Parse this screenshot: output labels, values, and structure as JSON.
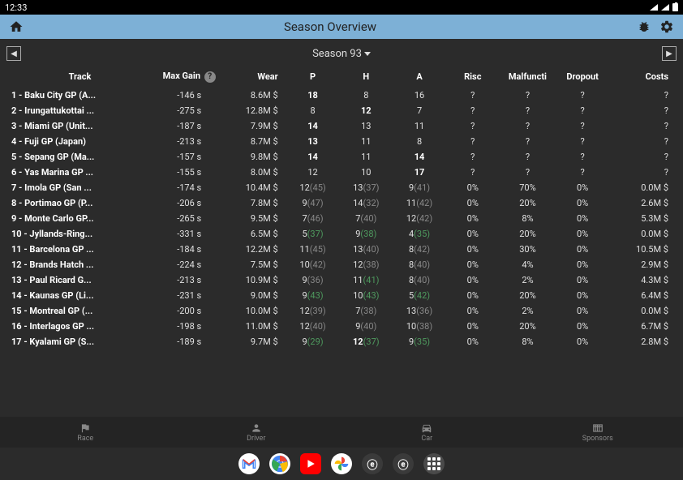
{
  "status_bar": {
    "time": "12:33"
  },
  "app_bar": {
    "title": "Season Overview"
  },
  "sub_header": {
    "season_label": "Season 93"
  },
  "table": {
    "headers": {
      "track": "Track",
      "max_gain": "Max Gain",
      "wear": "Wear",
      "p": "P",
      "h": "H",
      "a": "A",
      "risc": "Risc",
      "malfuncti": "Malfuncti",
      "dropout": "Dropout",
      "costs": "Costs"
    },
    "rows": [
      {
        "track": "1 - Baku City GP (A...",
        "max_gain": "-146 s",
        "wear": "8.6M $",
        "p": {
          "v": "18",
          "b": true
        },
        "h": {
          "v": "8"
        },
        "a": {
          "v": "16"
        },
        "risc": "?",
        "malf": "?",
        "drop": "?",
        "costs": "?"
      },
      {
        "track": "2 - Irungattukottai ...",
        "max_gain": "-275 s",
        "wear": "12.8M $",
        "p": {
          "v": "8"
        },
        "h": {
          "v": "12",
          "b": true
        },
        "a": {
          "v": "7"
        },
        "risc": "?",
        "malf": "?",
        "drop": "?",
        "costs": "?"
      },
      {
        "track": "3 - Miami GP (Unit...",
        "max_gain": "-187 s",
        "wear": "7.9M $",
        "p": {
          "v": "14",
          "b": true
        },
        "h": {
          "v": "13"
        },
        "a": {
          "v": "11"
        },
        "risc": "?",
        "malf": "?",
        "drop": "?",
        "costs": "?"
      },
      {
        "track": "4 - Fuji GP (Japan)",
        "max_gain": "-213 s",
        "wear": "8.7M $",
        "p": {
          "v": "13",
          "b": true
        },
        "h": {
          "v": "11"
        },
        "a": {
          "v": "8"
        },
        "risc": "?",
        "malf": "?",
        "drop": "?",
        "costs": "?"
      },
      {
        "track": "5 - Sepang GP (Ma...",
        "max_gain": "-157 s",
        "wear": "9.8M $",
        "p": {
          "v": "14",
          "b": true
        },
        "h": {
          "v": "11"
        },
        "a": {
          "v": "14",
          "b": true
        },
        "risc": "?",
        "malf": "?",
        "drop": "?",
        "costs": "?"
      },
      {
        "track": "6 - Yas Marina GP ...",
        "max_gain": "-155 s",
        "wear": "8.0M $",
        "p": {
          "v": "12"
        },
        "h": {
          "v": "10"
        },
        "a": {
          "v": "17",
          "b": true
        },
        "risc": "?",
        "malf": "?",
        "drop": "?",
        "costs": "?"
      },
      {
        "track": "7 - Imola GP (San ...",
        "max_gain": "-174 s",
        "wear": "10.4M $",
        "p": {
          "v": "12",
          "p": "(45)"
        },
        "h": {
          "v": "13",
          "p": "(37)"
        },
        "a": {
          "v": "9",
          "p": "(41)"
        },
        "risc": "0%",
        "malf": "70%",
        "drop": "0%",
        "costs": "0.0M $"
      },
      {
        "track": "8 - Portimao GP (P...",
        "max_gain": "-206 s",
        "wear": "7.8M $",
        "p": {
          "v": "9",
          "p": "(47)"
        },
        "h": {
          "v": "14",
          "p": "(32)"
        },
        "a": {
          "v": "11",
          "p": "(42)"
        },
        "risc": "0%",
        "malf": "20%",
        "drop": "0%",
        "costs": "2.6M $"
      },
      {
        "track": "9 - Monte Carlo GP...",
        "max_gain": "-265 s",
        "wear": "9.5M $",
        "p": {
          "v": "7",
          "p": "(46)"
        },
        "h": {
          "v": "7",
          "p": "(40)"
        },
        "a": {
          "v": "12",
          "p": "(42)"
        },
        "risc": "0%",
        "malf": "8%",
        "drop": "0%",
        "costs": "5.3M $"
      },
      {
        "track": "10 - Jyllands-Ring...",
        "max_gain": "-331 s",
        "wear": "6.5M $",
        "p": {
          "v": "5",
          "p": "(37)",
          "g": true
        },
        "h": {
          "v": "9",
          "p": "(38)",
          "g": true
        },
        "a": {
          "v": "4",
          "p": "(35)",
          "g": true
        },
        "risc": "0%",
        "malf": "20%",
        "drop": "0%",
        "costs": "0.0M $"
      },
      {
        "track": "11 - Barcelona GP ...",
        "max_gain": "-184 s",
        "wear": "12.2M $",
        "p": {
          "v": "11",
          "p": "(45)"
        },
        "h": {
          "v": "13",
          "p": "(40)"
        },
        "a": {
          "v": "8",
          "p": "(42)"
        },
        "risc": "0%",
        "malf": "30%",
        "drop": "0%",
        "costs": "10.5M $"
      },
      {
        "track": "12 - Brands Hatch ...",
        "max_gain": "-224 s",
        "wear": "7.5M $",
        "p": {
          "v": "10",
          "p": "(42)"
        },
        "h": {
          "v": "12",
          "p": "(38)"
        },
        "a": {
          "v": "8",
          "p": "(40)"
        },
        "risc": "0%",
        "malf": "4%",
        "drop": "0%",
        "costs": "2.9M $"
      },
      {
        "track": "13 - Paul Ricard G...",
        "max_gain": "-213 s",
        "wear": "10.9M $",
        "p": {
          "v": "9",
          "p": "(36)"
        },
        "h": {
          "v": "11",
          "p": "(41)",
          "g": true
        },
        "a": {
          "v": "8",
          "p": "(40)"
        },
        "risc": "0%",
        "malf": "2%",
        "drop": "0%",
        "costs": "4.3M $"
      },
      {
        "track": "14 - Kaunas GP (Li...",
        "max_gain": "-231 s",
        "wear": "9.0M $",
        "p": {
          "v": "9",
          "p": "(43)",
          "g": true
        },
        "h": {
          "v": "10",
          "p": "(43)",
          "g": true
        },
        "a": {
          "v": "5",
          "p": "(42)",
          "g": true
        },
        "risc": "0%",
        "malf": "20%",
        "drop": "0%",
        "costs": "6.4M $"
      },
      {
        "track": "15 - Montreal GP (...",
        "max_gain": "-200 s",
        "wear": "10.0M $",
        "p": {
          "v": "12",
          "p": "(39)"
        },
        "h": {
          "v": "7",
          "p": "(38)"
        },
        "a": {
          "v": "13",
          "p": "(36)"
        },
        "risc": "0%",
        "malf": "2%",
        "drop": "0%",
        "costs": "0.0M $"
      },
      {
        "track": "16 - Interlagos GP ...",
        "max_gain": "-198 s",
        "wear": "11.0M $",
        "p": {
          "v": "12",
          "p": "(40)"
        },
        "h": {
          "v": "9",
          "p": "(40)"
        },
        "a": {
          "v": "10",
          "p": "(38)"
        },
        "risc": "0%",
        "malf": "20%",
        "drop": "0%",
        "costs": "6.7M $"
      },
      {
        "track": "17 - Kyalami GP (S...",
        "max_gain": "-189 s",
        "wear": "9.7M $",
        "p": {
          "v": "9",
          "p": "(29)",
          "g": true
        },
        "h": {
          "v": "12",
          "p": "(37)",
          "g": true,
          "b": true
        },
        "a": {
          "v": "9",
          "p": "(35)",
          "g": true
        },
        "risc": "0%",
        "malf": "8%",
        "drop": "0%",
        "costs": "2.8M $"
      }
    ]
  },
  "bottom_nav": {
    "race": "Race",
    "driver": "Driver",
    "car": "Car",
    "sponsors": "Sponsors"
  }
}
